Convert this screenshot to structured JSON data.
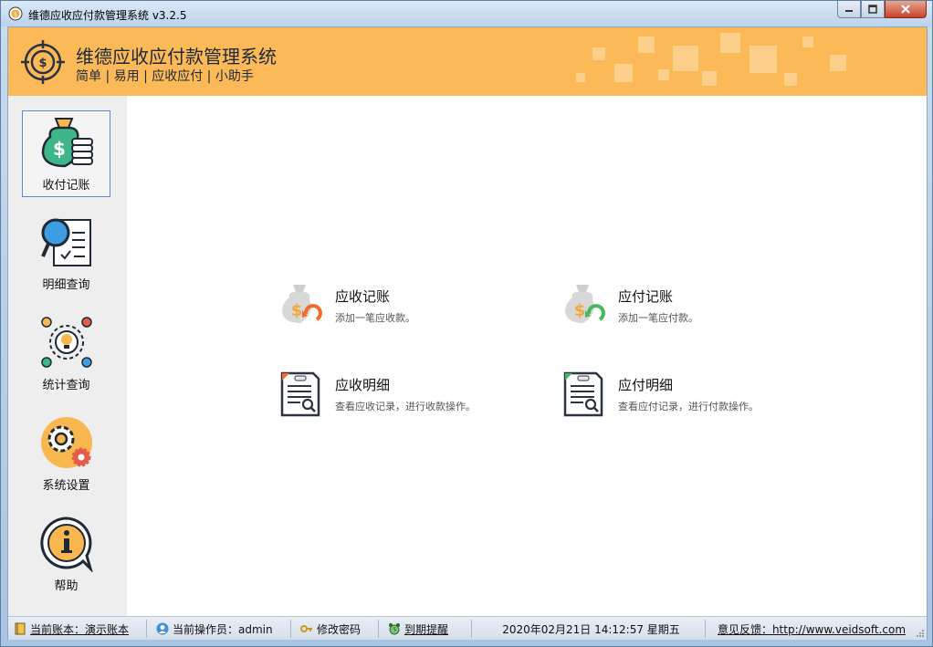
{
  "window": {
    "title": "维德应收应付款管理系统   v3.2.5"
  },
  "banner": {
    "title": "维德应收应付款管理系统",
    "subtitle": "简单 | 易用 | 应收应付 | 小助手"
  },
  "sidebar": {
    "items": [
      {
        "label": "收付记账",
        "icon": "money-bag-icon",
        "active": true
      },
      {
        "label": "明细查询",
        "icon": "magnifier-document-icon",
        "active": false
      },
      {
        "label": "统计查询",
        "icon": "lightbulb-cycle-icon",
        "active": false
      },
      {
        "label": "系统设置",
        "icon": "gears-icon",
        "active": false
      },
      {
        "label": "帮助",
        "icon": "info-bubble-icon",
        "active": false
      }
    ]
  },
  "main": {
    "tiles": [
      {
        "title": "应收记账",
        "desc": "添加一笔应收款。",
        "icon": "money-bag-receive-icon"
      },
      {
        "title": "应付记账",
        "desc": "添加一笔应付款。",
        "icon": "money-bag-pay-icon"
      },
      {
        "title": "应收明细",
        "desc": "查看应收记录，进行收款操作。",
        "icon": "receivable-report-icon"
      },
      {
        "title": "应付明细",
        "desc": "查看应付记录，进行付款操作。",
        "icon": "payable-report-icon"
      }
    ]
  },
  "statusbar": {
    "account": "当前账本：演示账本",
    "operator": "当前操作员：admin",
    "change_password": "修改密码",
    "due_reminder": "到期提醒",
    "datetime": "2020年02月21日 14:12:57 星期五",
    "feedback": "意见反馈：http://www.veidsoft.com"
  },
  "colors": {
    "banner": "#fbb957",
    "sidebar": "#eeeeee",
    "active_border": "#5a8ccc"
  }
}
